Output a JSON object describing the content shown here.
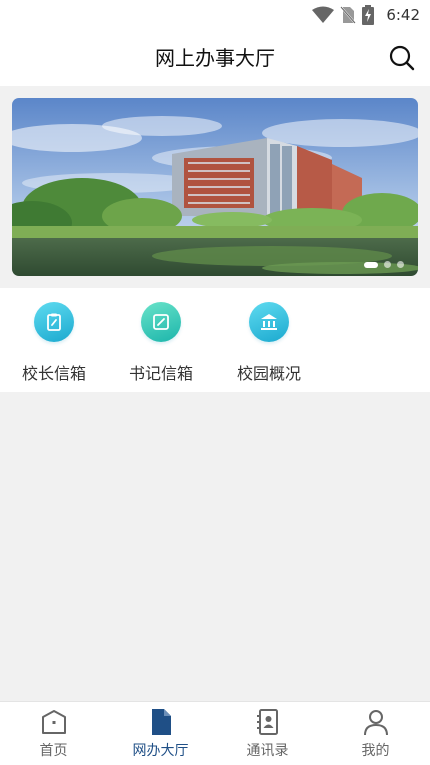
{
  "status_bar": {
    "time": "6:42"
  },
  "header": {
    "title": "网上办事大厅"
  },
  "quick_entries": [
    {
      "label": "校长信箱"
    },
    {
      "label": "书记信箱"
    },
    {
      "label": "校园概况"
    }
  ],
  "bottom_nav": [
    {
      "label": "首页",
      "active": false
    },
    {
      "label": "网办大厅",
      "active": true
    },
    {
      "label": "通讯录",
      "active": false
    },
    {
      "label": "我的",
      "active": false
    }
  ],
  "colors": {
    "active_nav": "#1f4f86",
    "icon_gradient_blue": "#1ba9cf",
    "icon_gradient_green": "#1cb5ab"
  },
  "banner": {
    "slide_count": 3,
    "active_slide": 1
  }
}
